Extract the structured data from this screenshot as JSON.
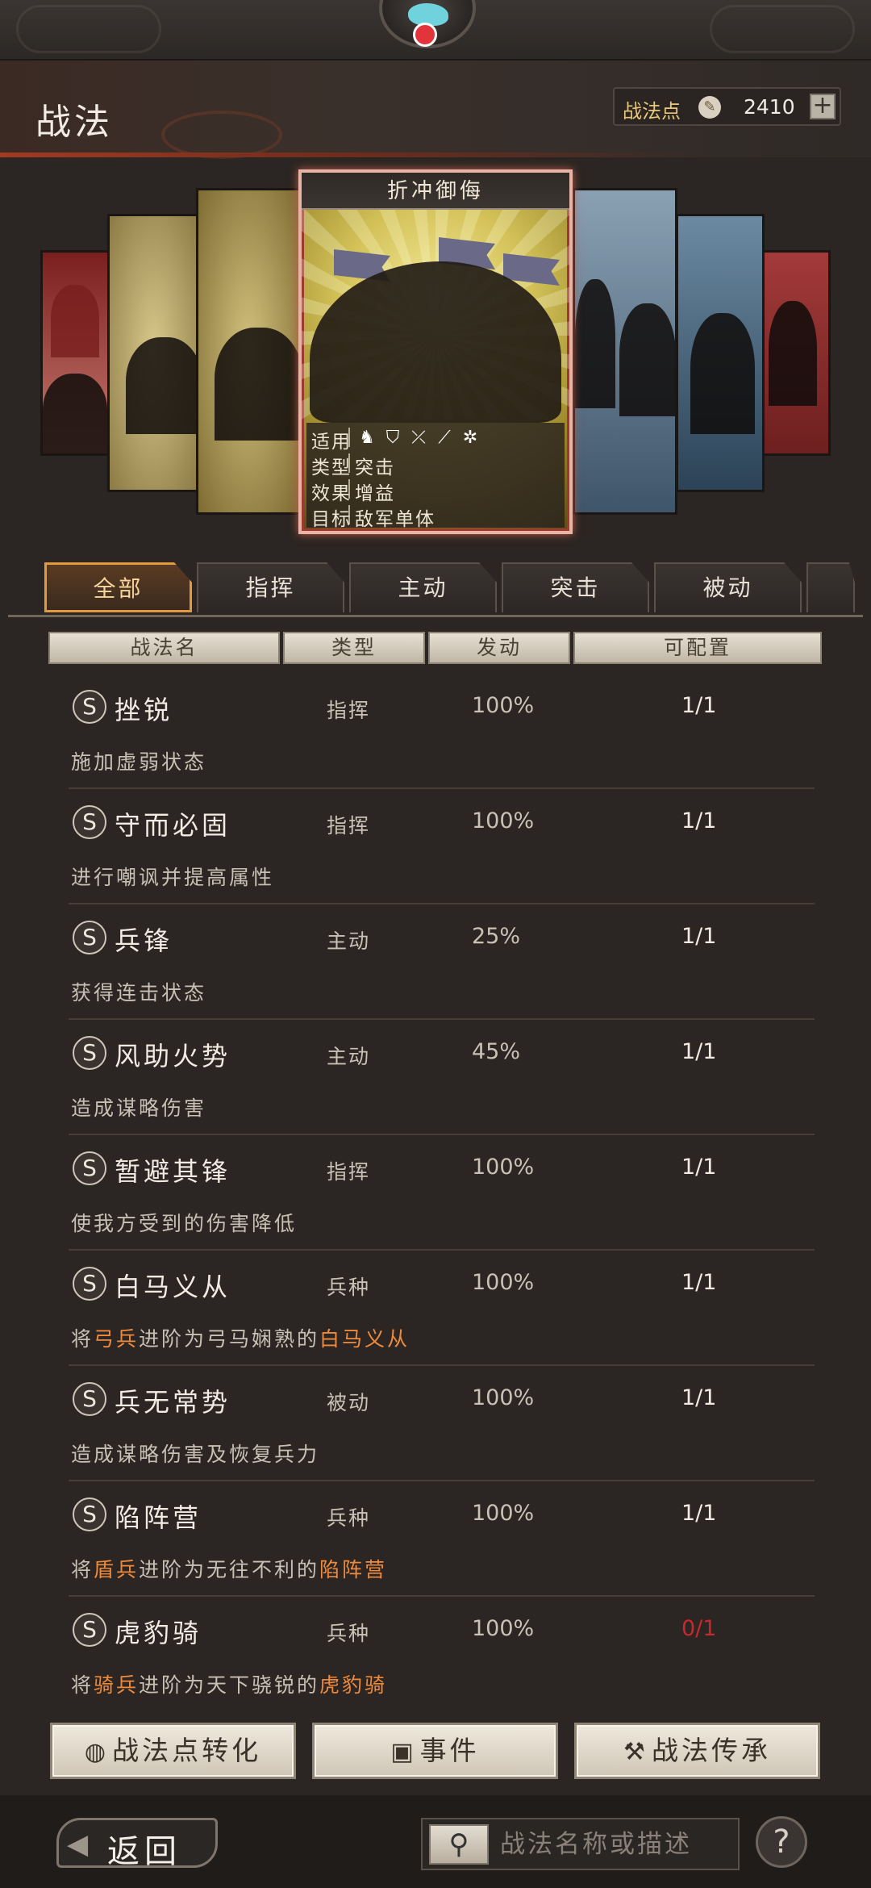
{
  "header": {
    "title": "战法",
    "points_label": "战法点",
    "points_value": "2410",
    "add_symbol": "+"
  },
  "feature_card": {
    "title": "折冲御侮",
    "applicable_label": "适用",
    "applicable_icons": [
      "cavalry-icon",
      "shield-icon",
      "bow-icon",
      "spear-icon",
      "siege-icon"
    ],
    "type_label": "类型",
    "type_value": "突击",
    "effect_label": "效果",
    "effect_value": "增益",
    "target_label": "目标",
    "target_value": "敌军单体"
  },
  "tabs": [
    {
      "label": "全部",
      "active": true
    },
    {
      "label": "指挥",
      "active": false
    },
    {
      "label": "主动",
      "active": false
    },
    {
      "label": "突击",
      "active": false
    },
    {
      "label": "被动",
      "active": false
    }
  ],
  "columns": {
    "name": "战法名",
    "type": "类型",
    "trigger": "发动",
    "allocatable": "可配置"
  },
  "skills": [
    {
      "grade": "S",
      "name": "挫锐",
      "type": "指挥",
      "rate": "100%",
      "alloc": "1/1",
      "desc": "施加虚弱状态"
    },
    {
      "grade": "S",
      "name": "守而必固",
      "type": "指挥",
      "rate": "100%",
      "alloc": "1/1",
      "desc": "进行嘲讽并提高属性"
    },
    {
      "grade": "S",
      "name": "兵锋",
      "type": "主动",
      "rate": "25%",
      "alloc": "1/1",
      "desc": "获得连击状态"
    },
    {
      "grade": "S",
      "name": "风助火势",
      "type": "主动",
      "rate": "45%",
      "alloc": "1/1",
      "desc": "造成谋略伤害"
    },
    {
      "grade": "S",
      "name": "暂避其锋",
      "type": "指挥",
      "rate": "100%",
      "alloc": "1/1",
      "desc": "使我方受到的伤害降低"
    },
    {
      "grade": "S",
      "name": "白马义从",
      "type": "兵种",
      "rate": "100%",
      "alloc": "1/1",
      "desc_pre": "将",
      "desc_hl1": "弓兵",
      "desc_mid": "进阶为弓马娴熟的",
      "desc_hl2": "白马义从"
    },
    {
      "grade": "S",
      "name": "兵无常势",
      "type": "被动",
      "rate": "100%",
      "alloc": "1/1",
      "desc": "造成谋略伤害及恢复兵力"
    },
    {
      "grade": "S",
      "name": "陷阵营",
      "type": "兵种",
      "rate": "100%",
      "alloc": "1/1",
      "desc_pre": "将",
      "desc_hl1": "盾兵",
      "desc_mid": "进阶为无往不利的",
      "desc_hl2": "陷阵营"
    },
    {
      "grade": "S",
      "name": "虎豹骑",
      "type": "兵种",
      "rate": "100%",
      "alloc": "0/1",
      "desc_pre": "将",
      "desc_hl1": "骑兵",
      "desc_mid": "进阶为天下骁锐的",
      "desc_hl2": "虎豹骑"
    }
  ],
  "buttons": {
    "convert": "战法点转化",
    "events": "事件",
    "inherit": "战法传承"
  },
  "footer": {
    "back": "返回",
    "search_placeholder": "战法名称或描述",
    "help": "?"
  },
  "colors": {
    "highlight": "#ef8a3c",
    "tab_active_border": "#e39a3e",
    "zero_alloc": "#c9282b"
  }
}
